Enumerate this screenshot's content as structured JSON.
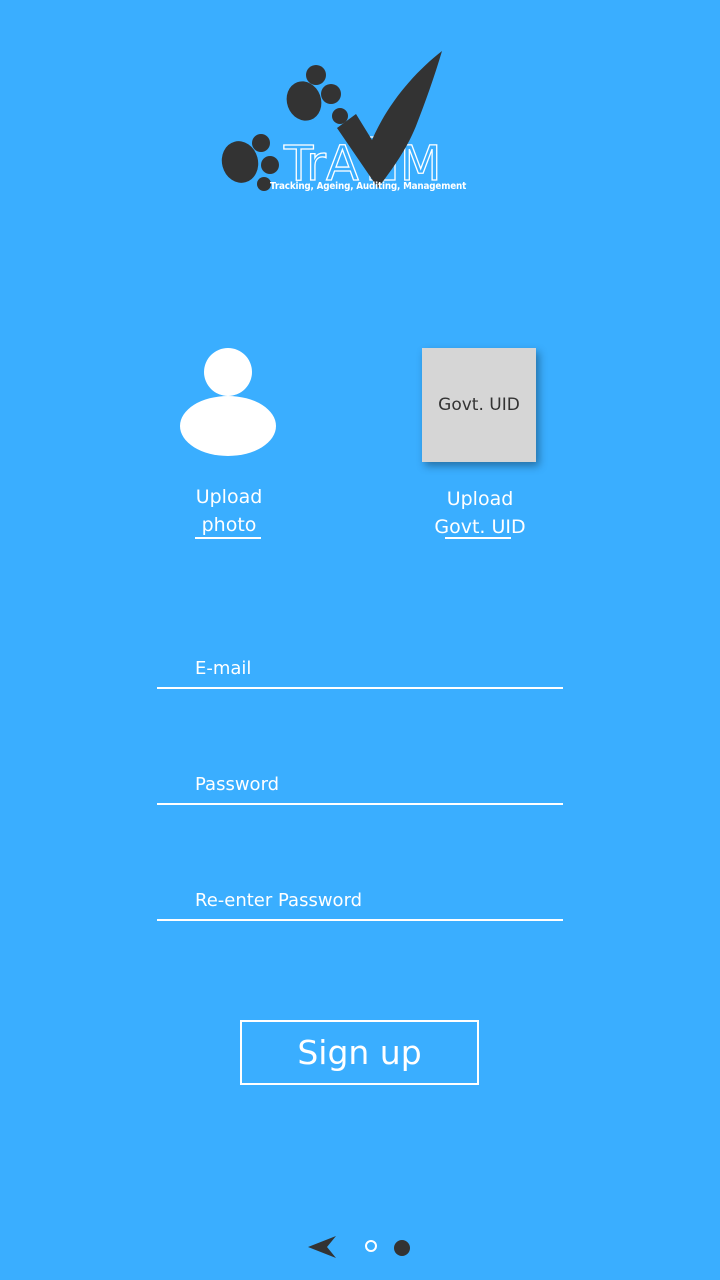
{
  "app": {
    "logo_text": "TrAAM",
    "tagline": "Tracking, Ageing, Auditing, Management"
  },
  "upload": {
    "photo_label_line1": "Upload",
    "photo_label_line2": "photo",
    "uid_card_text": "Govt. UID",
    "uid_label_line1": "Upload",
    "uid_label_line2": "Govt. UID"
  },
  "form": {
    "email_placeholder": "E-mail",
    "email_value": "",
    "password_placeholder": "Password",
    "password_value": "",
    "repassword_placeholder": "Re-enter Password",
    "repassword_value": "",
    "signup_label": "Sign up"
  },
  "pager": {
    "total_pages": 2,
    "current_page": 2
  },
  "colors": {
    "background": "#3AAEFF",
    "foreground": "#FFFFFF",
    "logo_dark": "#333333",
    "uid_card": "#D6D6D6"
  },
  "icons": {
    "logo_mark": "paw-checkmark-icon",
    "avatar": "user-avatar-icon",
    "back": "back-arrow-icon"
  }
}
